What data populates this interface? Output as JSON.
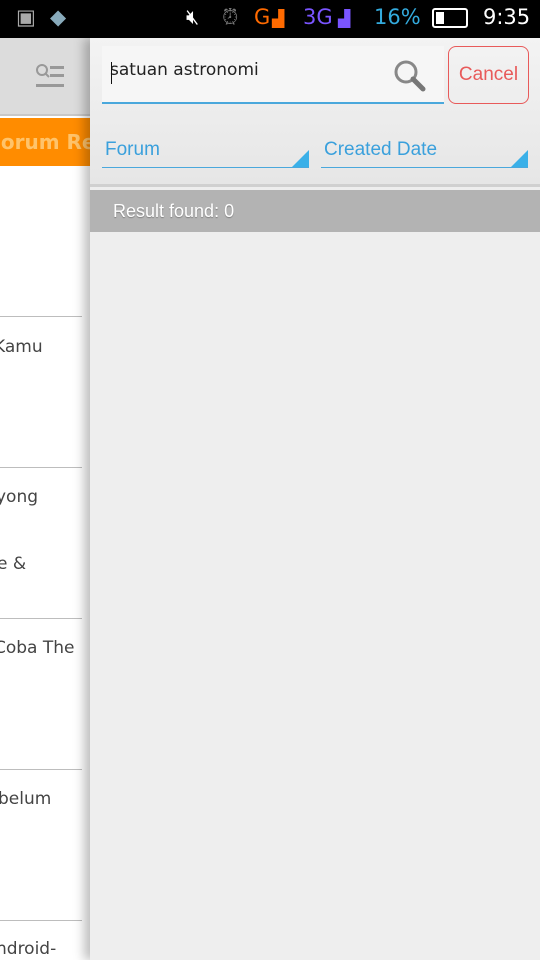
{
  "status_bar": {
    "network": "G",
    "network2": "3G",
    "battery": "16%",
    "time": "9:35",
    "icons": [
      "bbm-icon",
      "app-icon",
      "mute-icon",
      "alarm-icon",
      "signal-icon",
      "battery-icon"
    ]
  },
  "left_panel": {
    "tab_label": "Forum Revi",
    "items": [
      "Kamu",
      "yong",
      "e &",
      "Coba The",
      "belum",
      "ndroid-"
    ]
  },
  "search": {
    "value": "satuan astronomi",
    "cancel_label": "Cancel"
  },
  "filters": {
    "forum": "Forum",
    "sort": "Created Date"
  },
  "result": {
    "text": "Result found: 0"
  },
  "colors": {
    "accent": "#3aa0dc",
    "cancel": "#e85a5a",
    "orange": "#ff8c00"
  }
}
